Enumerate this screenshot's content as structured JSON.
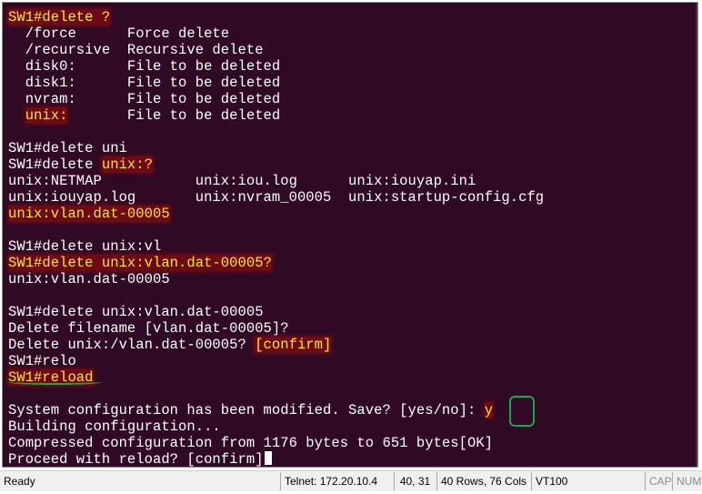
{
  "terminal": {
    "background": "#300a24",
    "foreground": "#ffffff",
    "highlight_text": "#f7e53b",
    "annotation_color": "#17a84a",
    "lines": [
      [
        {
          "t": "SW1#delete ?",
          "y": true,
          "b": true
        }
      ],
      [
        {
          "t": "  /force      Force delete"
        }
      ],
      [
        {
          "t": "  /recursive  Recursive delete"
        }
      ],
      [
        {
          "t": "  disk0:      File to be deleted"
        }
      ],
      [
        {
          "t": "  disk1:      File to be deleted"
        }
      ],
      [
        {
          "t": "  nvram:      File to be deleted"
        }
      ],
      [
        {
          "t": "  "
        },
        {
          "t": "unix:",
          "y": true,
          "b": true
        },
        {
          "t": "       File to be deleted"
        }
      ],
      [
        {
          "t": ""
        }
      ],
      [
        {
          "t": "SW1#delete uni"
        }
      ],
      [
        {
          "t": "SW1#delete "
        },
        {
          "t": "unix:?",
          "y": true,
          "b": true
        }
      ],
      [
        {
          "t": "unix:NETMAP           unix:iou.log      unix:iouyap.ini"
        }
      ],
      [
        {
          "t": "unix:iouyap.log       unix:nvram_00005  unix:startup-config.cfg"
        }
      ],
      [
        {
          "t": "unix:vlan.dat-00005",
          "y": true,
          "b": true
        }
      ],
      [
        {
          "t": ""
        }
      ],
      [
        {
          "t": "SW1#delete unix:vl"
        }
      ],
      [
        {
          "t": "SW1#delete unix:vlan.dat-00005?",
          "y": true,
          "b": true
        }
      ],
      [
        {
          "t": "unix:vlan.dat-00005"
        }
      ],
      [
        {
          "t": ""
        }
      ],
      [
        {
          "t": "SW1#delete unix:vlan.dat-00005"
        }
      ],
      [
        {
          "t": "Delete filename [vlan.dat-00005]?"
        }
      ],
      [
        {
          "t": "Delete unix:/vlan.dat-00005? "
        },
        {
          "t": "[confirm]",
          "y": true,
          "b": true
        }
      ],
      [
        {
          "t": "SW1#relo"
        }
      ],
      [
        {
          "t": "SW1#reload",
          "y": true,
          "b": true
        }
      ],
      [
        {
          "t": ""
        }
      ],
      [
        {
          "t": "System configuration has been modified. Save? [yes/no]: "
        },
        {
          "t": "y",
          "y": true,
          "b": true
        }
      ],
      [
        {
          "t": "Building configuration..."
        }
      ],
      [
        {
          "t": "Compressed configuration from 1176 bytes to 651 bytes[OK]"
        }
      ],
      [
        {
          "t": "Proceed with reload? [confirm]",
          "cursor": true
        }
      ]
    ]
  },
  "status_bar": {
    "ready": "Ready",
    "connection": "Telnet: 172.20.10.4",
    "cursor_pos": "40,  31",
    "dimensions": "40 Rows, 76 Cols",
    "emulation": "VT100",
    "caps": "CAP",
    "num": "NUM"
  }
}
